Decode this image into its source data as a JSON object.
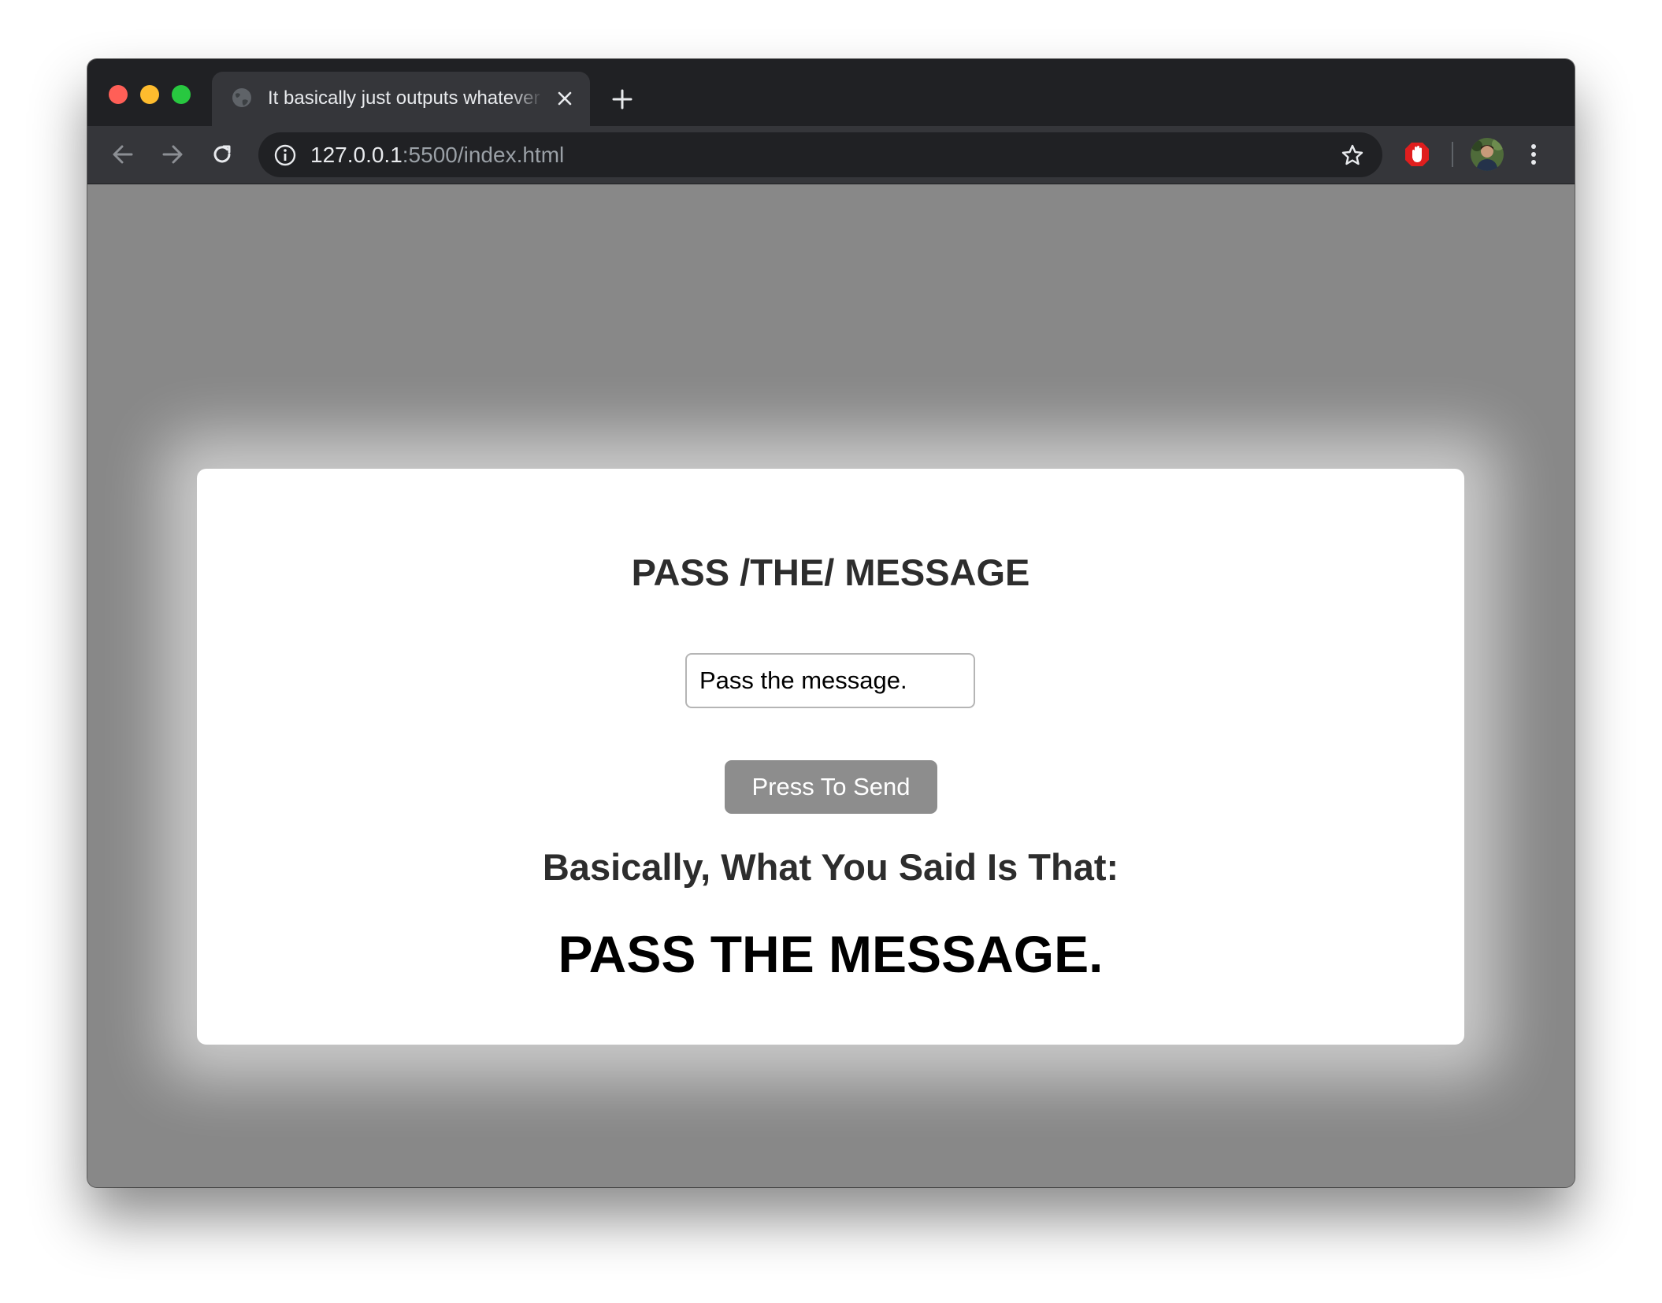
{
  "browser": {
    "tab": {
      "title": "It basically just outputs whatever you say",
      "favicon": "globe-icon"
    },
    "address_bar": {
      "host": "127.0.0.1",
      "path": ":5500/index.html"
    },
    "colors": {
      "titlebar": "#202124",
      "toolbar": "#35363a",
      "close": "#ff5f57",
      "minimize": "#febc2e",
      "maximize": "#28c840"
    }
  },
  "page": {
    "title": "PASS /THE/ MESSAGE",
    "input_value": "Pass the message.",
    "send_button_label": "Press To Send",
    "result_label": "Basically, What You Said Is That:",
    "result_output": "PASS THE MESSAGE.",
    "colors": {
      "background": "#888888",
      "card": "#ffffff",
      "button": "#8d8d8d"
    }
  }
}
